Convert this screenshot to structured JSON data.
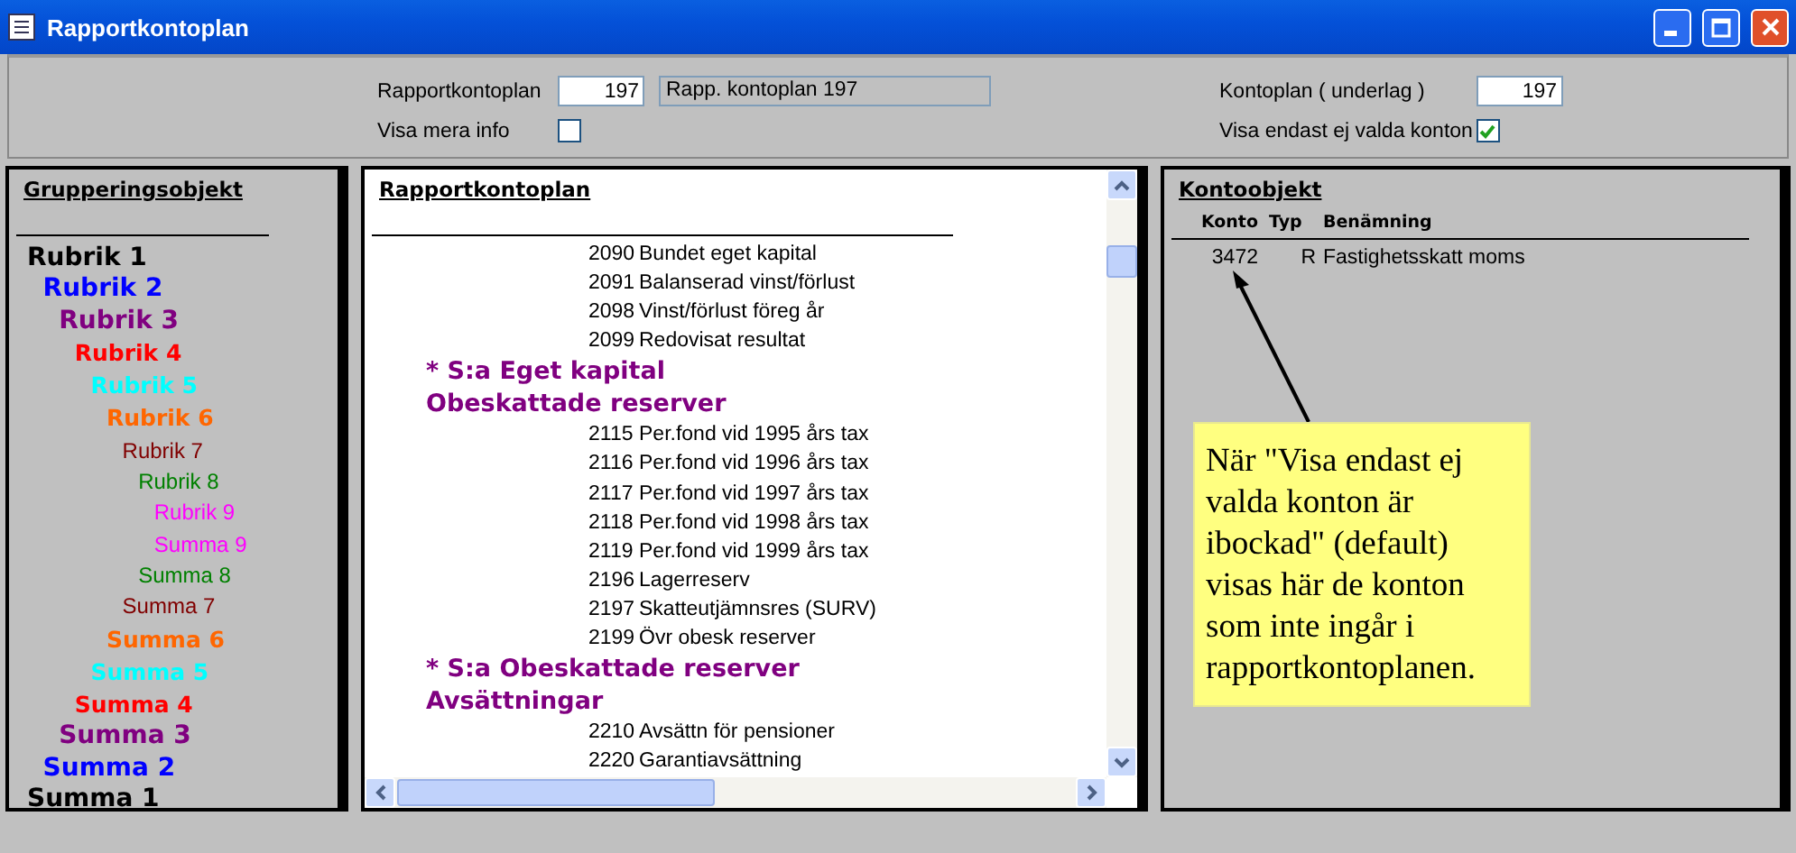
{
  "window": {
    "title": "Rapportkontoplan"
  },
  "form": {
    "plan_label": "Rapportkontoplan",
    "plan_value": "197",
    "plan_name": "Rapp. kontoplan 197",
    "more_info_label": "Visa mera info",
    "more_info_checked": false,
    "base_label": "Kontoplan ( underlag )",
    "base_value": "197",
    "only_unselected_label": "Visa endast ej valda konton",
    "only_unselected_checked": true
  },
  "grouping": {
    "title": "Grupperingsobjekt",
    "levels": [
      {
        "heading": "Rubrik 1",
        "total": "Summa 1",
        "color": "#000000",
        "children": [
          {
            "heading": "Rubrik 2",
            "total": "Summa 2",
            "color": "#0000ff",
            "children": [
              {
                "heading": "Rubrik 3",
                "total": "Summa 3",
                "color": "#800080",
                "children": [
                  {
                    "heading": "Rubrik 4",
                    "total": "Summa 4",
                    "color": "#ff0000",
                    "children": [
                      {
                        "heading": "Rubrik 5",
                        "total": "Summa 5",
                        "color": "#00ffff",
                        "children": [
                          {
                            "heading": "Rubrik 6",
                            "total": "Summa 6",
                            "color": "#ff6600",
                            "children": [
                              {
                                "heading": "Rubrik 7",
                                "total": "Summa 7",
                                "color": "#800000",
                                "children": [
                                  {
                                    "heading": "Rubrik 8",
                                    "total": "Summa 8",
                                    "color": "#008000",
                                    "children": [
                                      {
                                        "heading": "Rubrik 9",
                                        "total": "Summa 9",
                                        "color": "#ff00ff"
                                      }
                                    ]
                                  }
                                ]
                              }
                            ]
                          }
                        ]
                      }
                    ]
                  }
                ]
              }
            ]
          }
        ]
      }
    ]
  },
  "report_plan": {
    "title": "Rapportkontoplan",
    "rows": [
      {
        "kind": "account",
        "number": "2090",
        "name": "Bundet eget kapital"
      },
      {
        "kind": "account",
        "number": "2091",
        "name": "Balanserad vinst/förlust"
      },
      {
        "kind": "account",
        "number": "2098",
        "name": "Vinst/förlust föreg år"
      },
      {
        "kind": "account",
        "number": "2099",
        "name": "Redovisat resultat"
      },
      {
        "kind": "group",
        "label": "* S:a Eget kapital"
      },
      {
        "kind": "group",
        "label": "Obeskattade reserver"
      },
      {
        "kind": "account",
        "number": "2115",
        "name": "Per.fond vid 1995 års tax"
      },
      {
        "kind": "account",
        "number": "2116",
        "name": "Per.fond vid 1996 års tax"
      },
      {
        "kind": "account",
        "number": "2117",
        "name": "Per.fond vid 1997 års tax"
      },
      {
        "kind": "account",
        "number": "2118",
        "name": "Per.fond vid 1998 års tax"
      },
      {
        "kind": "account",
        "number": "2119",
        "name": "Per.fond vid 1999 års tax"
      },
      {
        "kind": "account",
        "number": "2196",
        "name": "Lagerreserv"
      },
      {
        "kind": "account",
        "number": "2197",
        "name": "Skatteutjämnsres (SURV)"
      },
      {
        "kind": "account",
        "number": "2199",
        "name": "Övr obesk reserver"
      },
      {
        "kind": "group",
        "label": "* S:a Obeskattade reserver"
      },
      {
        "kind": "group",
        "label": "Avsättningar"
      },
      {
        "kind": "account",
        "number": "2210",
        "name": "Avsättn för pensioner"
      },
      {
        "kind": "account",
        "number": "2220",
        "name": "Garantiavsättning"
      }
    ]
  },
  "accounts": {
    "title": "Kontoobjekt",
    "columns": [
      "Konto",
      "Typ",
      "Benämning"
    ],
    "rows": [
      {
        "konto": "3472",
        "typ": "R",
        "name": "Fastighetsskatt moms"
      }
    ]
  },
  "note": {
    "text": "När \"Visa endast ej valda konton är ibockad\" (default) visas här de konton som inte ingår i rapportkontoplanen."
  }
}
